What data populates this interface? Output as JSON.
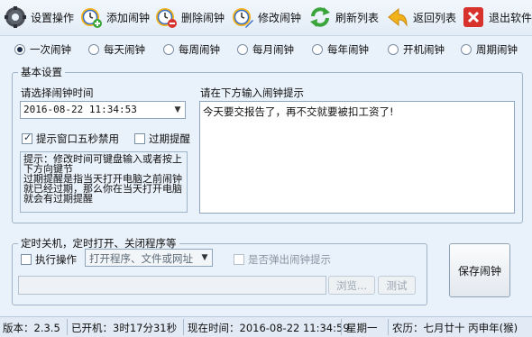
{
  "toolbar": {
    "settings": "设置操作",
    "add": "添加闹钟",
    "delete": "删除闹钟",
    "edit": "修改闹钟",
    "refresh": "刷新列表",
    "back": "返回列表",
    "exit": "退出软件"
  },
  "modes": [
    "一次闹钟",
    "每天闹钟",
    "每周闹钟",
    "每月闹钟",
    "每年闹钟",
    "开机闹钟",
    "周期闹钟"
  ],
  "selected_mode": "一次闹钟",
  "basic": {
    "legend": "基本设置",
    "time_label": "请选择闹钟时间",
    "datetime": "2016-08-22  11:34:53",
    "popup_disable": "提示窗口五秒禁用",
    "popup_disable_checked": true,
    "expired_remind": "过期提醒",
    "expired_remind_checked": false,
    "tip_lines": [
      "提示：修改时间可键盘输入或者按上",
      "下方向键节",
      "过期提醒是指当天打开电脑之前闹钟",
      "就已经过期，那么你在当天打开电脑",
      "就会有过期提醒"
    ],
    "memo_label": "请在下方输入闹钟提示",
    "memo_text": "今天要交报告了，再不交就要被扣工资了!"
  },
  "timer": {
    "legend": "定时关机，定时打开、关闭程序等",
    "exec_label": "执行操作",
    "exec_checked": false,
    "program_select": "打开程序、文件或网址",
    "popup_label": "是否弹出闹钟提示",
    "popup_checked": false,
    "path_value": "",
    "browse": "浏览...",
    "test": "测试"
  },
  "save_button": "保存闹钟",
  "status": {
    "version": "版本：2.3.5",
    "uptime": "已开机：3时17分31秒",
    "now": "现在时间：2016-08-22  11:34:59",
    "weekday": "星期一",
    "lunar": "农历：七月廿十  丙申年(猴)"
  },
  "colors": {
    "window_bg": "#e9f1fa",
    "border": "#9fb3c9",
    "refresh_green": "#3aa53a",
    "exit_red": "#d8322c",
    "clock_blue": "#3a6fc4",
    "badge_yellow": "#f2b21b"
  },
  "icons": {
    "settings": "gear-icon",
    "add": "alarm-clock-add-icon",
    "delete": "alarm-clock-delete-icon",
    "edit": "alarm-clock-edit-icon",
    "refresh": "refresh-arrows-icon",
    "back": "back-arrow-icon",
    "exit": "close-x-icon"
  }
}
